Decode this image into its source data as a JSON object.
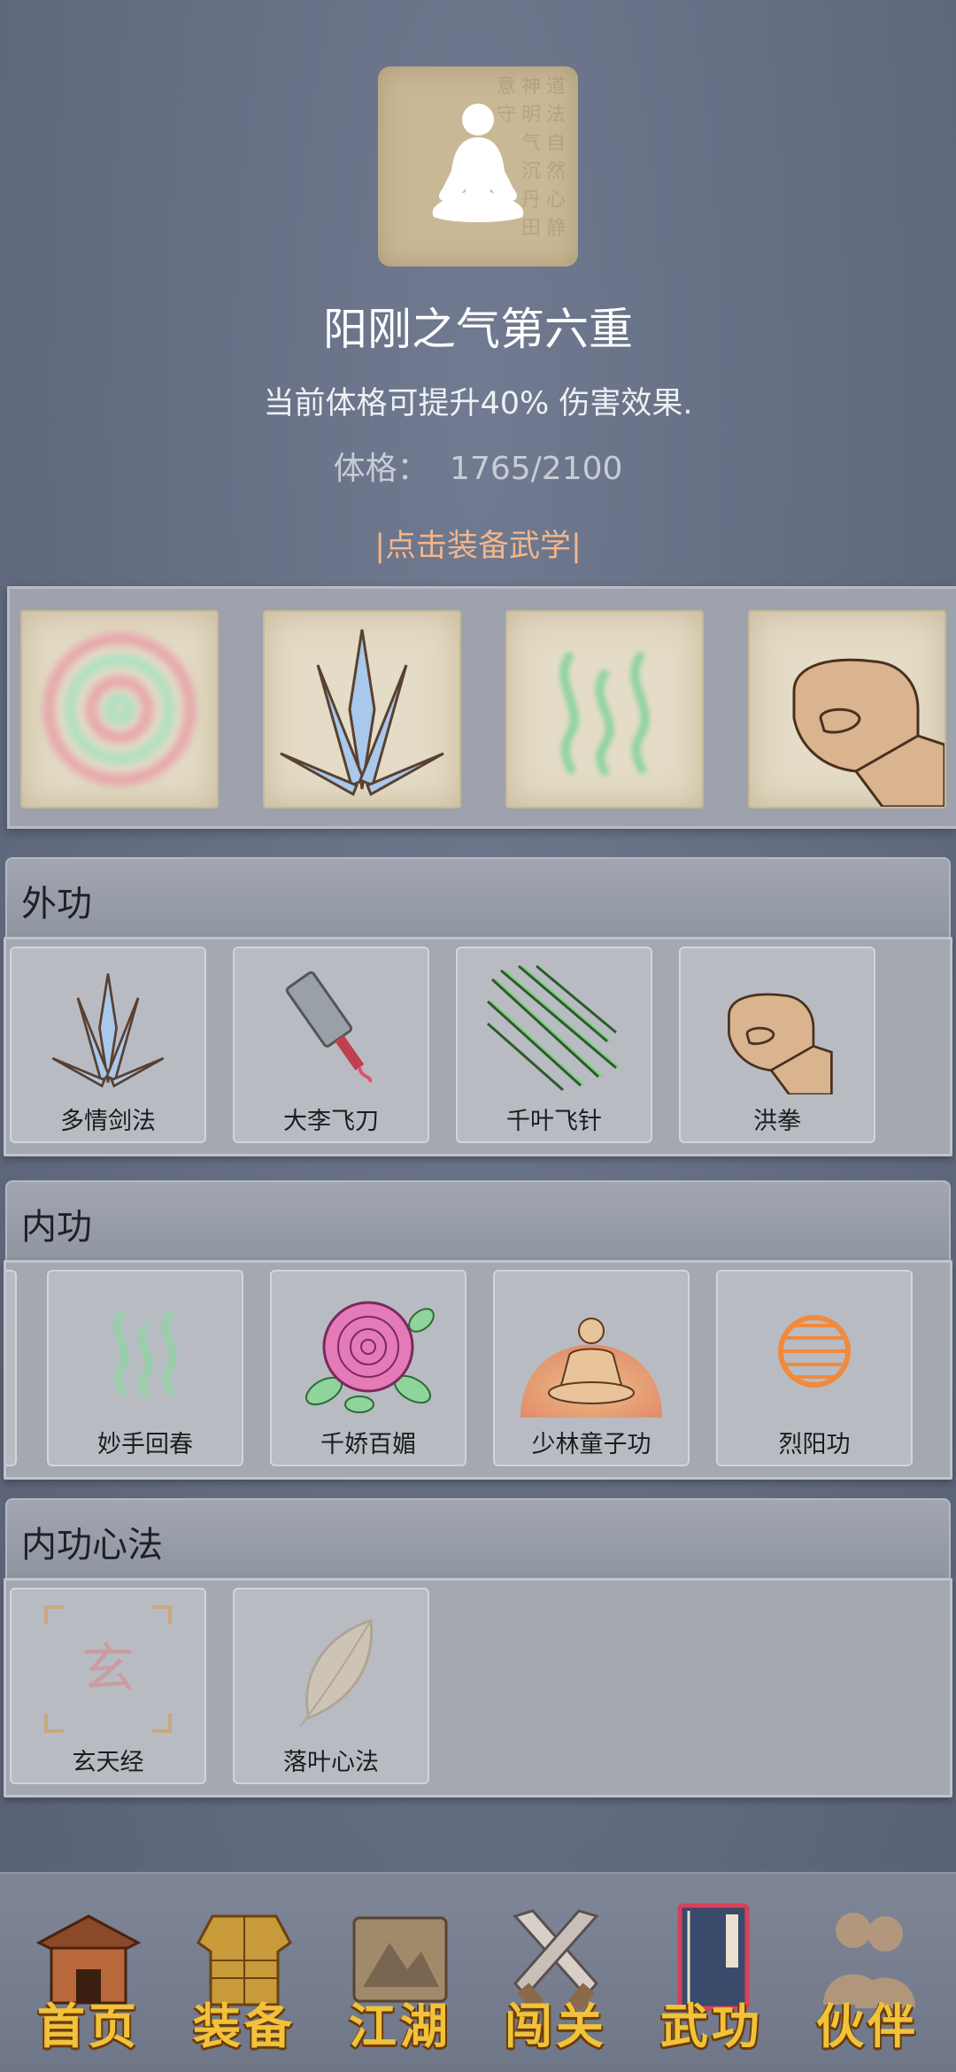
{
  "header": {
    "title": "阳刚之气第六重",
    "description": "当前体格可提升40% 伤害效果.",
    "stat_label": "体格：",
    "stat_value": "1765/2100",
    "equip_link": "|点击装备武学|"
  },
  "equipped": [
    {
      "icon": "spiral-icon"
    },
    {
      "icon": "sword-fan-icon"
    },
    {
      "icon": "qi-waves-icon"
    },
    {
      "icon": "fist-icon"
    }
  ],
  "sections": [
    {
      "title": "外功",
      "skills": [
        {
          "name": "多情剑法",
          "icon": "sword-fan-icon"
        },
        {
          "name": "大李飞刀",
          "icon": "flying-knife-icon"
        },
        {
          "name": "千叶飞针",
          "icon": "needles-icon"
        },
        {
          "name": "洪拳",
          "icon": "fist-icon"
        }
      ]
    },
    {
      "title": "内功",
      "skills": [
        {
          "name": "妙手回春",
          "icon": "qi-waves-icon"
        },
        {
          "name": "千娇百媚",
          "icon": "rose-icon"
        },
        {
          "name": "少林童子功",
          "icon": "meditating-monk-icon"
        },
        {
          "name": "烈阳功",
          "icon": "sun-orb-icon"
        }
      ]
    },
    {
      "title": "内功心法",
      "skills": [
        {
          "name": "玄天经",
          "icon": "scroll-seal-icon"
        },
        {
          "name": "落叶心法",
          "icon": "leaf-icon"
        }
      ]
    }
  ],
  "nav": [
    {
      "label": "首页",
      "icon": "temple-icon"
    },
    {
      "label": "装备",
      "icon": "armor-icon"
    },
    {
      "label": "江湖",
      "icon": "map-scroll-icon"
    },
    {
      "label": "闯关",
      "icon": "crossed-swords-icon"
    },
    {
      "label": "武功",
      "icon": "martial-book-icon"
    },
    {
      "label": "伙伴",
      "icon": "companions-icon"
    }
  ],
  "colors": {
    "background": "#6b7488",
    "link": "#f3b58a",
    "nav_label": "#f1c23a"
  }
}
